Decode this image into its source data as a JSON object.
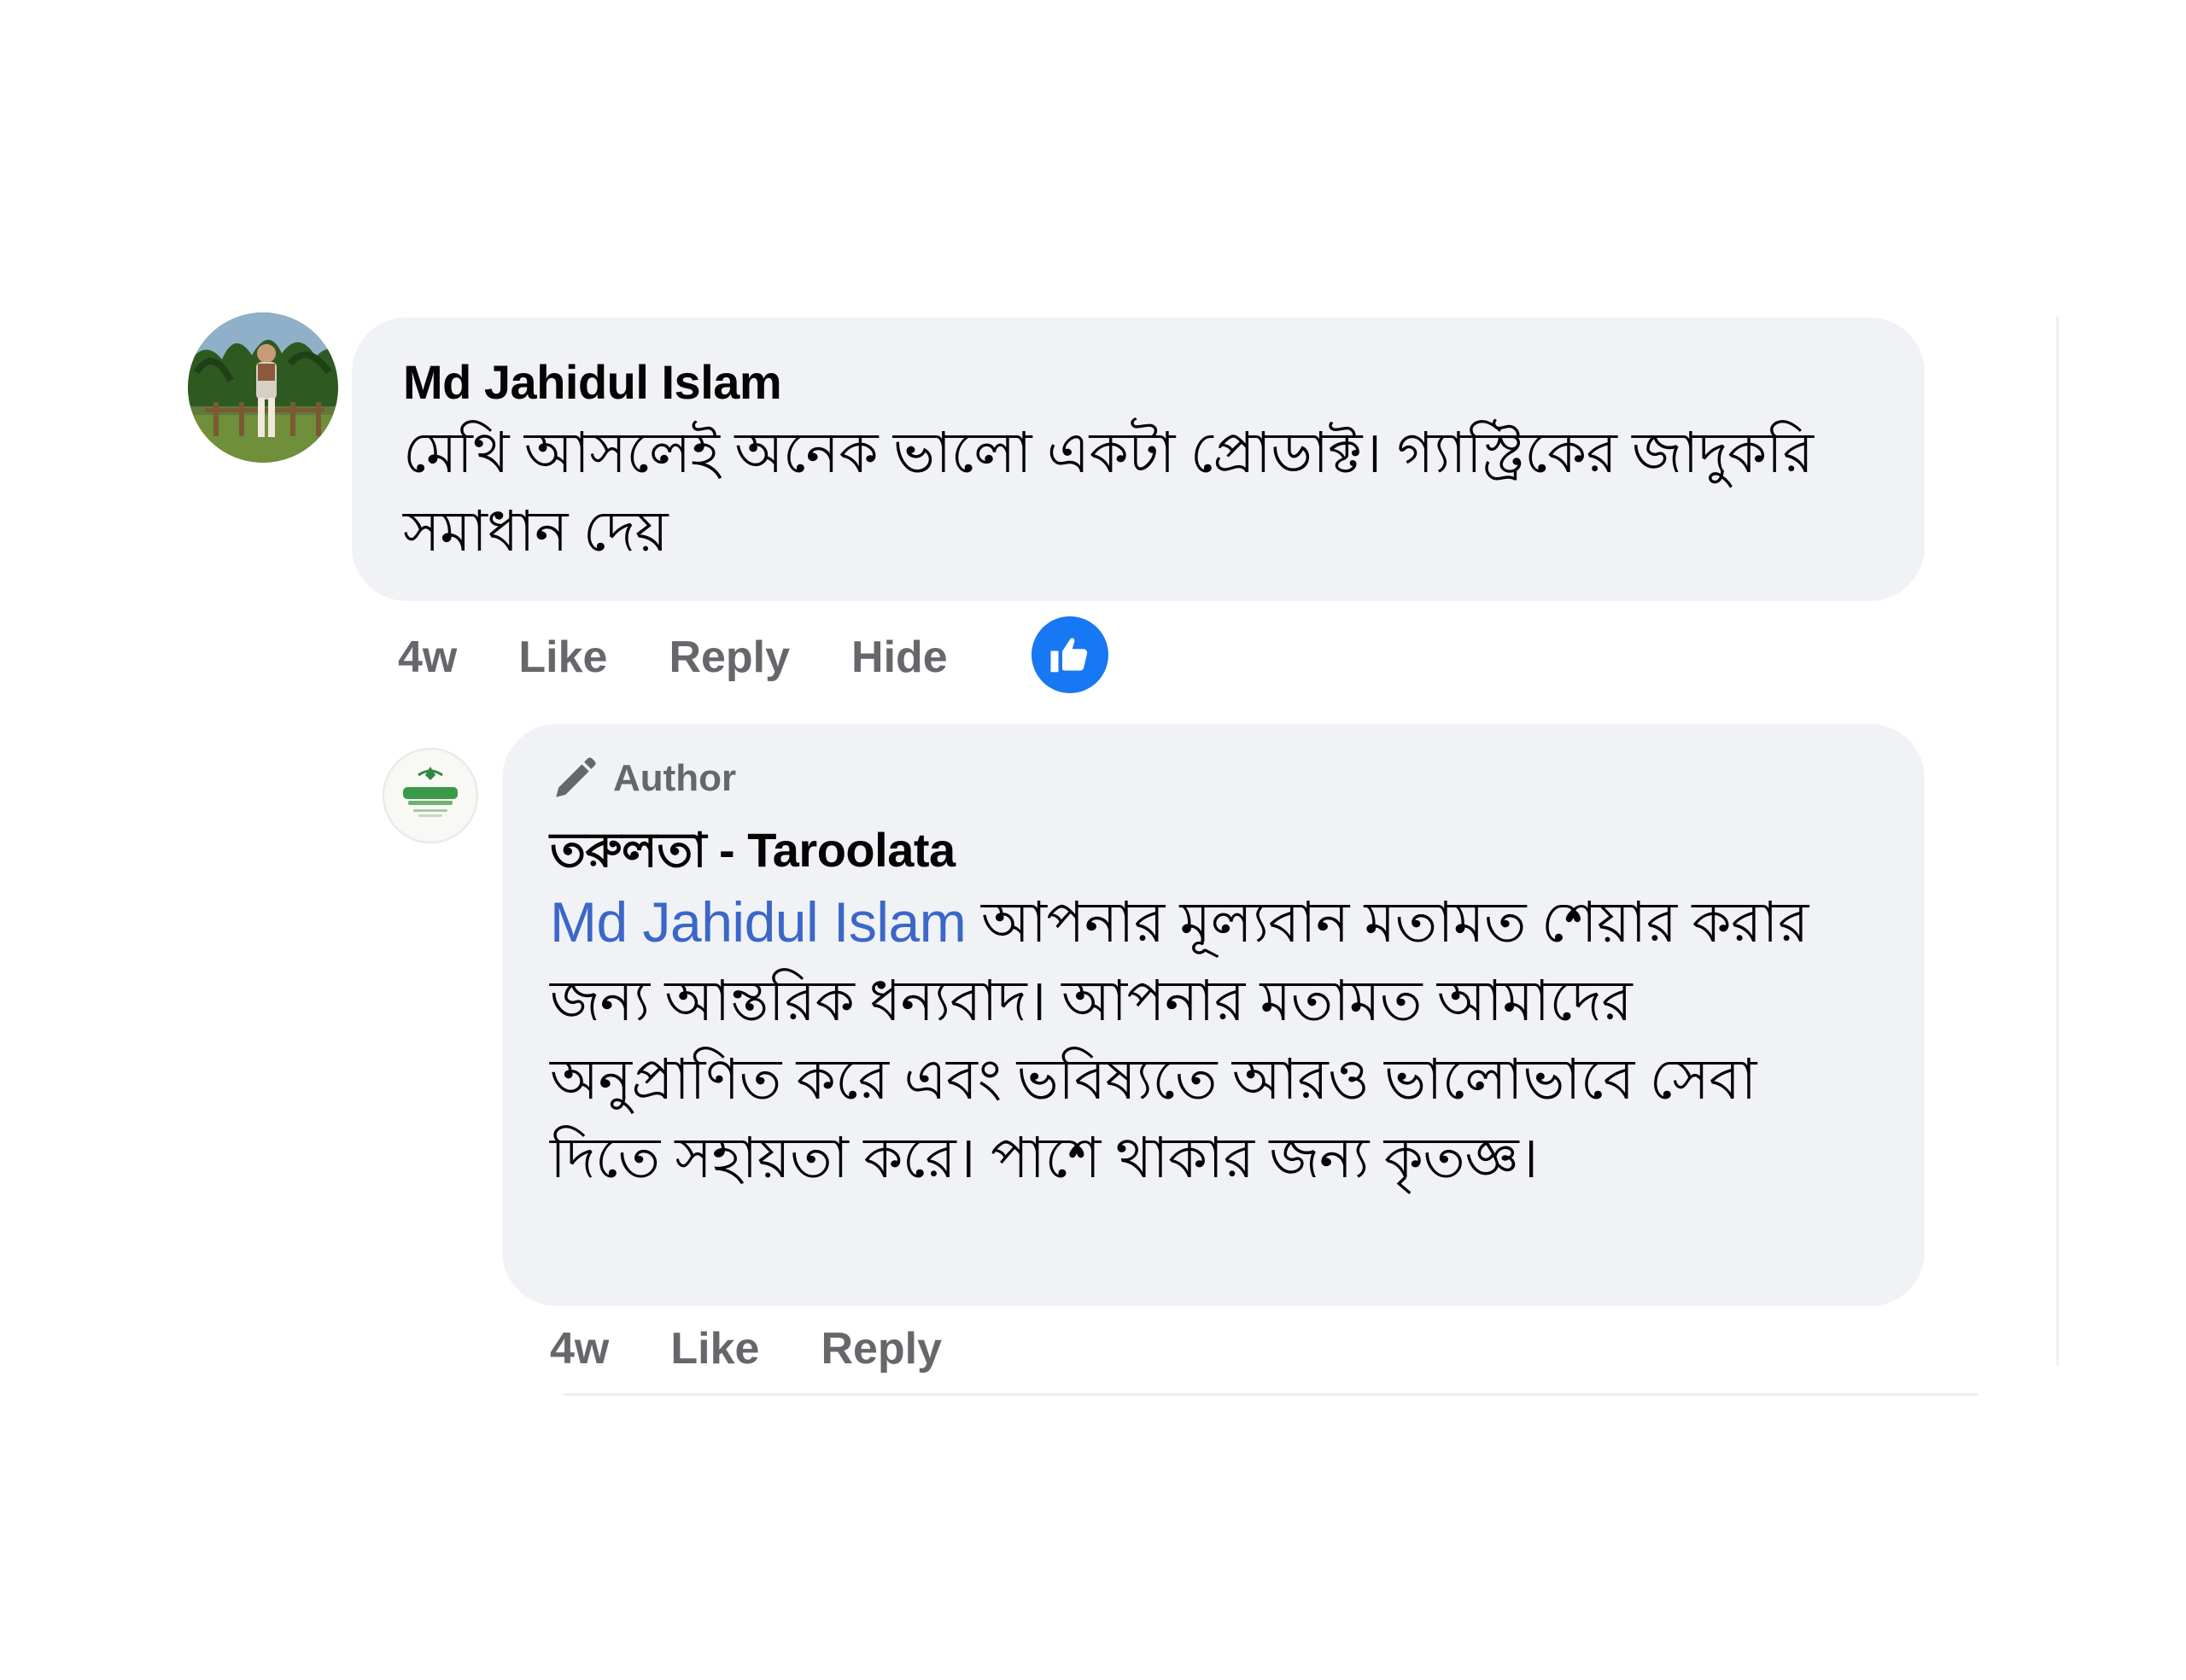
{
  "comment": {
    "author": "Md Jahidul Islam",
    "text": "মেথি আসলেই অনেক ভালো একটা প্রোডাক্ট। গ্যাস্ট্রিকের জাদুকরি সমাধান দেয়",
    "time": "4w",
    "like_label": "Like",
    "reply_label": "Reply",
    "hide_label": "Hide",
    "reaction_icon": "thumbs-up-icon",
    "reaction_color": "#1877f2"
  },
  "reply": {
    "badge": "Author",
    "badge_icon": "pen-icon",
    "author": "তরুলতা - Taroolata",
    "mention": "Md Jahidul Islam",
    "text": " আপনার মূল্যবান মতামত শেয়ার করার জন্য আন্তরিক ধন্যবাদ। আপনার মতামত আমাদের অনুপ্রাণিত করে এবং ভবিষ্যতে আরও ভালোভাবে সেবা দিতে সহায়তা করে। পাশে থাকার জন্য কৃতজ্ঞ।",
    "time": "4w",
    "like_label": "Like",
    "reply_label": "Reply",
    "mention_color": "#3b67c9"
  },
  "colors": {
    "bubble": "#f0f2f5",
    "secondary_text": "#65676b",
    "primary_text": "#050505"
  }
}
